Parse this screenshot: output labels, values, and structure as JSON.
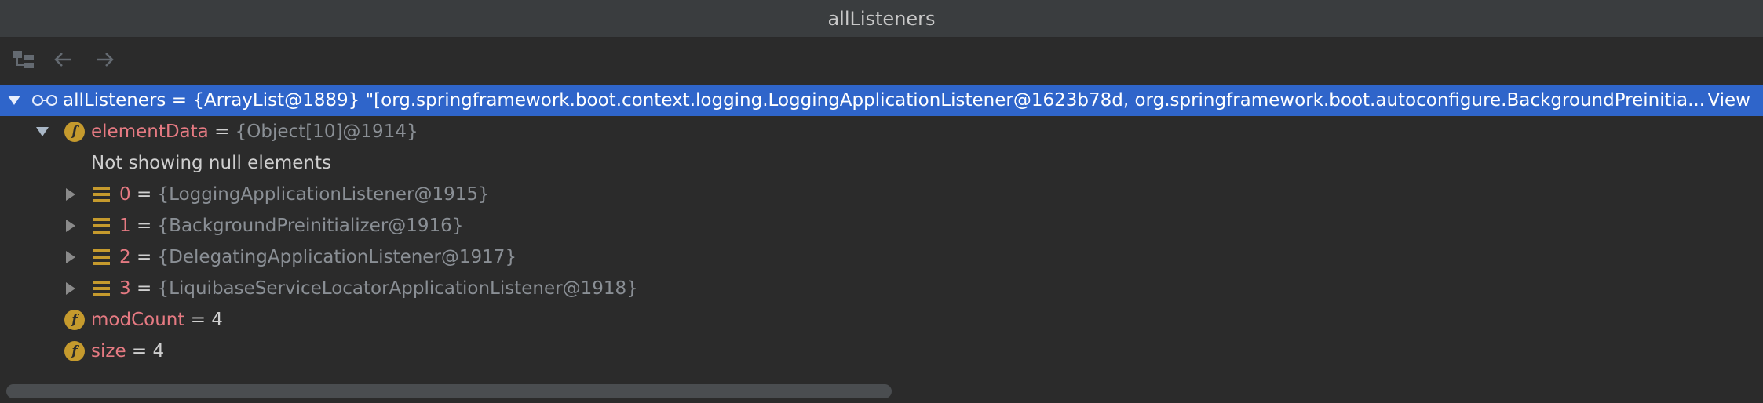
{
  "window": {
    "title": "allListeners"
  },
  "toolbar": {
    "icons": [
      "tree-layout-icon",
      "back-arrow-icon",
      "forward-arrow-icon"
    ]
  },
  "tree": {
    "root": {
      "name": "allListeners",
      "eq": " = ",
      "value": "{ArrayList@1889} \"[org.springframework.boot.context.logging.LoggingApplicationListener@1623b78d, org.springframework.boot.autoconfigure.BackgroundPreinitia...",
      "view_link": "View"
    },
    "elementData": {
      "name": "elementData",
      "eq": " = ",
      "value": "{Object[10]@1914}"
    },
    "note": "Not showing null elements",
    "items": [
      {
        "index": "0",
        "eq": " = ",
        "value": "{LoggingApplicationListener@1915}"
      },
      {
        "index": "1",
        "eq": " = ",
        "value": "{BackgroundPreinitializer@1916}"
      },
      {
        "index": "2",
        "eq": " = ",
        "value": "{DelegatingApplicationListener@1917}"
      },
      {
        "index": "3",
        "eq": " = ",
        "value": "{LiquibaseServiceLocatorApplicationListener@1918}"
      }
    ],
    "modCount": {
      "name": "modCount",
      "eq": " = ",
      "value": "4"
    },
    "size": {
      "name": "size",
      "eq": " = ",
      "value": "4"
    }
  },
  "colors": {
    "selection": "#2f65ca",
    "field_name": "#e57a82",
    "field_icon": "#c59a2d",
    "muted_value": "#8a8f95"
  }
}
